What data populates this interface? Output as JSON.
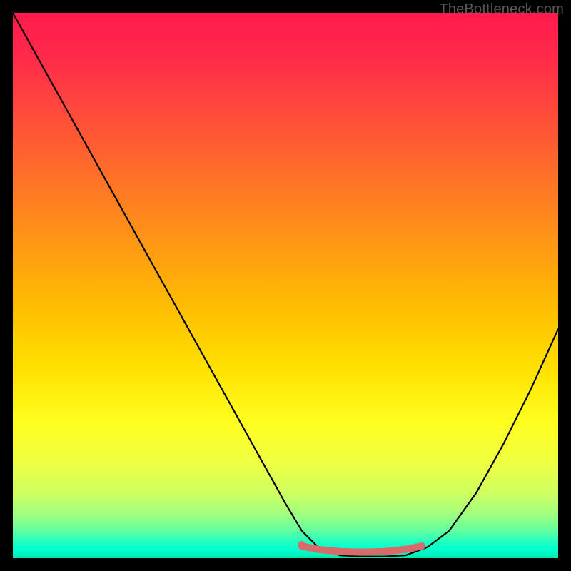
{
  "watermark": "TheBottleneck.com",
  "chart_data": {
    "type": "line",
    "title": "",
    "xlabel": "",
    "ylabel": "",
    "xlim": [
      0,
      100
    ],
    "ylim": [
      0,
      100
    ],
    "series": [
      {
        "name": "bottleneck-curve",
        "color": "#000000",
        "x": [
          0,
          5,
          10,
          15,
          20,
          25,
          30,
          35,
          40,
          45,
          50,
          53,
          56,
          60,
          64,
          68,
          72,
          76,
          80,
          85,
          90,
          95,
          100
        ],
        "y": [
          100,
          91,
          82,
          73,
          64,
          55,
          46,
          37,
          28,
          19,
          10,
          5,
          2,
          0.5,
          0.3,
          0.3,
          0.5,
          2,
          5,
          12,
          21,
          31,
          42
        ]
      },
      {
        "name": "optimal-range-marker",
        "color": "#d96a6a",
        "x": [
          53,
          56,
          60,
          64,
          68,
          72,
          75
        ],
        "y": [
          2.2,
          1.6,
          1.2,
          1.1,
          1.2,
          1.6,
          2.2
        ]
      }
    ],
    "marker": {
      "name": "optimal-start-dot",
      "color": "#d96a6a",
      "x": 53,
      "y": 2.5,
      "radius_px": 5
    },
    "grid": false,
    "legend": false
  }
}
